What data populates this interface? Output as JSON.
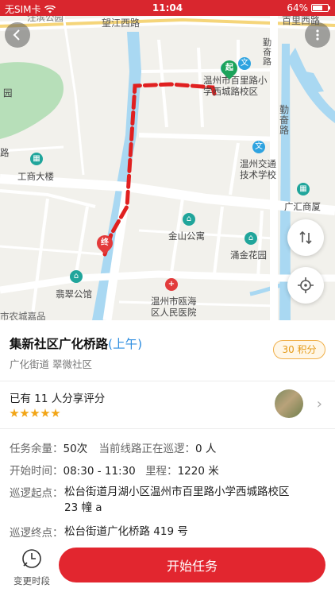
{
  "status_bar": {
    "carrier": "无SIM卡",
    "time": "11:04",
    "battery": "64%",
    "battery_level": 0.64
  },
  "map": {
    "roads": [
      "望江西路",
      "百里西路",
      "勤奋路",
      "广汇商厦"
    ],
    "places": {
      "place_top_left": "汪滨公园",
      "school": "温州市百里路小学西城路校区",
      "school_line1": "温州市百里路小",
      "school_line2": "学西城路校区",
      "transport_school_line1": "温州交通",
      "transport_school_line2": "技术学校",
      "gongshang": "工商大楼",
      "jinshan": "金山公寓",
      "yongjin": "涌金花园",
      "feicui": "翡翠公馆",
      "hospital_line1": "温州市瓯海",
      "hospital_line2": "区人民医院",
      "partial_left": "园",
      "partial_left2": "路",
      "partial_bottom": "市农城嘉品"
    },
    "start_marker": "起",
    "end_marker": "终",
    "icons": {
      "back": "back-arrow-icon",
      "more": "more-dots-icon",
      "route_switch": "route-switch-icon",
      "locate": "locate-crosshair-icon"
    }
  },
  "task": {
    "title": "集新社区广化桥路",
    "time_tag": "(上午)",
    "points": "30 积分",
    "sub_address": "广化街道 翠微社区",
    "share_text": "已有 11 人分享评分",
    "rating": 5,
    "remaining_label": "任务余量：",
    "remaining_value": "50次",
    "patrolling_label": "当前线路正在巡逻：",
    "patrolling_value": "0 人",
    "start_time_label": "开始时间：",
    "start_time_value": "08:30 - 11:30",
    "mileage_label": "里程：",
    "mileage_value": "1220 米",
    "start_point_label": "巡逻起点：",
    "start_point_value": "松台街道月湖小区温州市百里路小学西城路校区 23 幢 a",
    "end_point_label": "巡逻终点：",
    "end_point_value": "松台街道广化桥路 419 号"
  },
  "bottom_bar": {
    "change_time_label": "变更时段",
    "start_button": "开始任务"
  },
  "colors": {
    "brand_red": "#e2262f",
    "route_red": "#e02020",
    "points_orange": "#e59a16",
    "link_blue": "#2f8ee0"
  }
}
